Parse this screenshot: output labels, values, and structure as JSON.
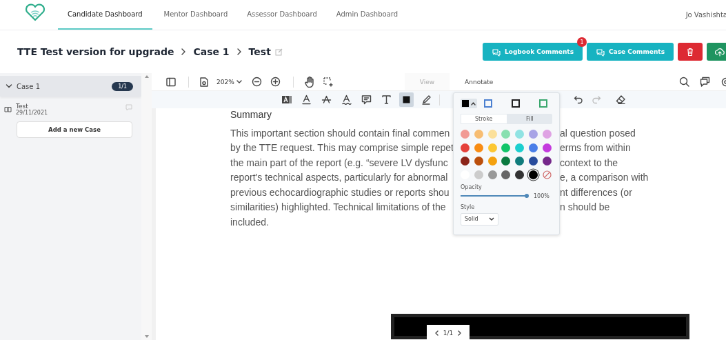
{
  "nav": {
    "tabs": [
      {
        "label": "Candidate Dashboard",
        "selected": true
      },
      {
        "label": "Mentor Dashboard",
        "selected": false
      },
      {
        "label": "Assessor Dashboard",
        "selected": false
      },
      {
        "label": "Admin Dashboard",
        "selected": false
      }
    ],
    "user": "Jo Vashishta"
  },
  "breadcrumb": [
    "TTE Test version for upgrade",
    "Case 1",
    "Test"
  ],
  "actions": [
    {
      "kind": "comments",
      "label": "Logbook Comments",
      "badge": "1"
    },
    {
      "kind": "comments",
      "label": "Case Comments"
    },
    {
      "kind": "delete"
    },
    {
      "kind": "upload"
    }
  ],
  "sidebar": {
    "groups": [
      {
        "title": "Case 1",
        "count": "1/1",
        "expanded": true,
        "items": [
          {
            "title": "Test",
            "date": "29/11/2021"
          }
        ]
      }
    ],
    "add_button": "Add a new Case"
  },
  "viewer": {
    "zoom": "202%",
    "modes": [
      {
        "label": "View",
        "selected": false
      },
      {
        "label": "Annotate",
        "selected": true
      }
    ],
    "tools": [
      {
        "kind": "free-text",
        "selected": false
      },
      {
        "kind": "underline",
        "selected": false
      },
      {
        "kind": "strike",
        "selected": false
      },
      {
        "kind": "squiggly",
        "selected": false
      },
      {
        "kind": "note",
        "selected": false
      },
      {
        "kind": "text",
        "selected": false
      },
      {
        "kind": "rectangle",
        "selected": true
      },
      {
        "kind": "pen",
        "selected": false
      }
    ],
    "document": {
      "heading": "Summary",
      "lines": [
        {
          "left": "This important section should contain final commen",
          "right": "al question posed"
        },
        {
          "left": "by the TTE request. This may comprise simple repet",
          "right": "erms from within"
        },
        {
          "left": "the main part of the report (e.g. “severe LV dysfunc",
          "right": "context to the"
        },
        {
          "left": "report's technical aspects, particularly for abnormal",
          "right": "e, a comparison with"
        },
        {
          "left": "previous echocardiographic studies or reports shou",
          "right": "nt differences (or"
        },
        {
          "left": "similarities) highlighted. Technical limitations of the",
          "right": "n should be"
        },
        {
          "left": "included."
        }
      ]
    },
    "color_panel": {
      "presets": [
        {
          "color": "#4a7fd0"
        },
        {
          "color": "#222222"
        },
        {
          "color": "#3aa76d"
        }
      ],
      "tabs": [
        {
          "label": "Stroke",
          "selected": true
        },
        {
          "label": "Fill",
          "selected": false
        }
      ],
      "swatches": [
        {
          "kind": "color",
          "color": "#f19a94",
          "selected": false
        },
        {
          "kind": "color",
          "color": "#f7bd72",
          "selected": false
        },
        {
          "kind": "color",
          "color": "#fbe09a",
          "selected": false
        },
        {
          "kind": "color",
          "color": "#88e0b0",
          "selected": false
        },
        {
          "kind": "color",
          "color": "#90e3e3",
          "selected": false
        },
        {
          "kind": "color",
          "color": "#a8a4e6",
          "selected": false
        },
        {
          "kind": "color",
          "color": "#dfa3e4",
          "selected": false
        },
        {
          "kind": "color",
          "color": "#e5413b",
          "selected": false
        },
        {
          "kind": "color",
          "color": "#f88c14",
          "selected": false
        },
        {
          "kind": "color",
          "color": "#fcc733",
          "selected": false
        },
        {
          "kind": "color",
          "color": "#12c56a",
          "selected": false
        },
        {
          "kind": "color",
          "color": "#1ccfcf",
          "selected": false
        },
        {
          "kind": "color",
          "color": "#4a7ee8",
          "selected": false
        },
        {
          "kind": "color",
          "color": "#c43bde",
          "selected": false
        },
        {
          "kind": "color",
          "color": "#8b2419",
          "selected": false
        },
        {
          "kind": "color",
          "color": "#bb4f0c",
          "selected": false
        },
        {
          "kind": "color",
          "color": "#f4a10f",
          "selected": false
        },
        {
          "kind": "color",
          "color": "#0b7a40",
          "selected": false
        },
        {
          "kind": "color",
          "color": "#107c7c",
          "selected": false
        },
        {
          "kind": "color",
          "color": "#284c9c",
          "selected": false
        },
        {
          "kind": "color",
          "color": "#75288a",
          "selected": false
        },
        {
          "kind": "color",
          "color": "#ffffff",
          "selected": false
        },
        {
          "kind": "color",
          "color": "#cccccc",
          "selected": false
        },
        {
          "kind": "color",
          "color": "#999999",
          "selected": false
        },
        {
          "kind": "color",
          "color": "#666666",
          "selected": false
        },
        {
          "kind": "color",
          "color": "#333333",
          "selected": false
        },
        {
          "kind": "color",
          "color": "#000000",
          "selected": true
        },
        {
          "kind": "none",
          "selected": false
        }
      ],
      "opacity": {
        "label": "Opacity",
        "level": 1,
        "reading": "100%"
      },
      "style": {
        "label": "Style",
        "value": "Solid"
      }
    },
    "page_nav": "1/1"
  }
}
